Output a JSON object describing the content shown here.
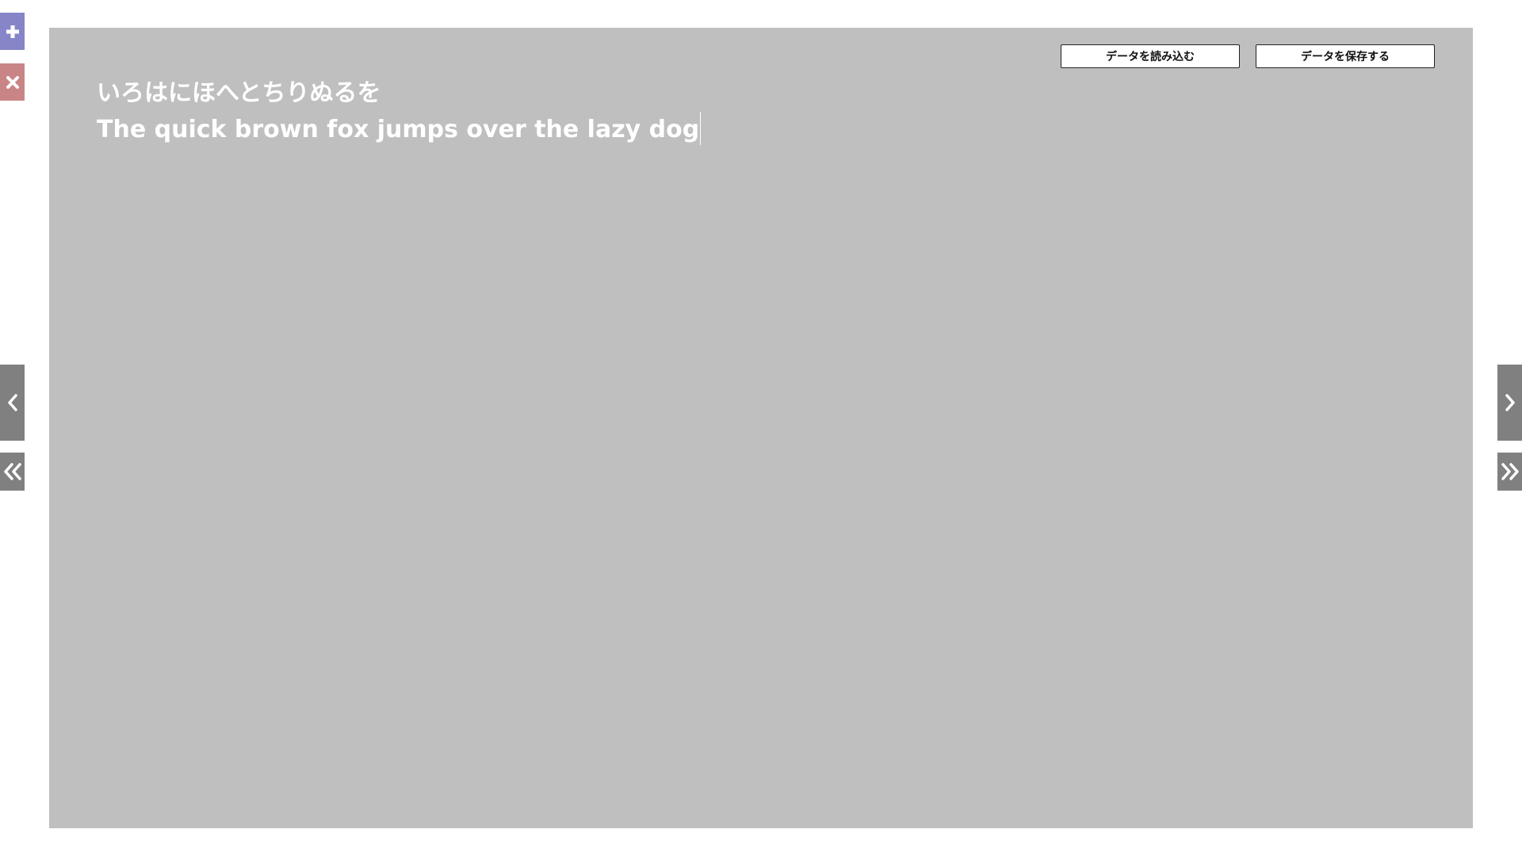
{
  "controls": {
    "add_icon": "plus-icon",
    "delete_icon": "close-icon",
    "prev_icon": "chevron-left-icon",
    "first_icon": "double-chevron-left-icon",
    "next_icon": "chevron-right-icon",
    "last_icon": "double-chevron-right-icon",
    "add_color": "#8585c8",
    "delete_color": "#c98585",
    "nav_color": "#808080"
  },
  "canvas": {
    "background": "#bfbfbf",
    "load_button_label": "データを読み込む",
    "save_button_label": "データを保存する",
    "lines": [
      "いろはにほへとちりぬるを",
      "The quick brown fox jumps over the lazy dog"
    ]
  }
}
